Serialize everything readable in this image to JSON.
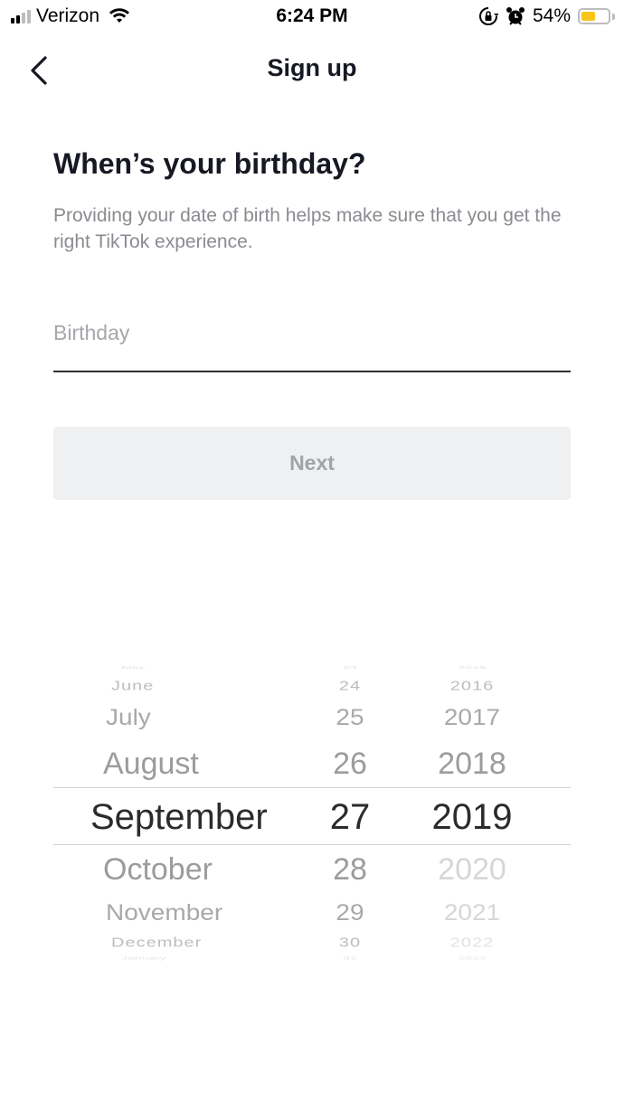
{
  "status_bar": {
    "carrier": "Verizon",
    "time": "6:24 PM",
    "battery_percent_label": "54%",
    "battery_level": 0.54,
    "battery_color": "#f7c51a",
    "icons": [
      "signal-icon",
      "wifi-icon",
      "rotation-lock-icon",
      "alarm-icon",
      "battery-icon"
    ]
  },
  "nav": {
    "title": "Sign up",
    "back_icon": "chevron-left-icon"
  },
  "content": {
    "headline": "When’s your birthday?",
    "subtext": "Providing your date of birth helps make sure that you get the right TikTok experience.",
    "birthday_field": {
      "value": "",
      "placeholder": "Birthday"
    },
    "next_button": "Next"
  },
  "date_picker": {
    "months": [
      "May",
      "June",
      "July",
      "August",
      "September",
      "October",
      "November",
      "December",
      "January"
    ],
    "days": [
      "23",
      "24",
      "25",
      "26",
      "27",
      "28",
      "29",
      "30",
      "31"
    ],
    "years": [
      "2015",
      "2016",
      "2017",
      "2018",
      "2019",
      "2020",
      "2021",
      "2022",
      "2023"
    ],
    "selected": {
      "month": "September",
      "day": "27",
      "year": "2019"
    }
  }
}
